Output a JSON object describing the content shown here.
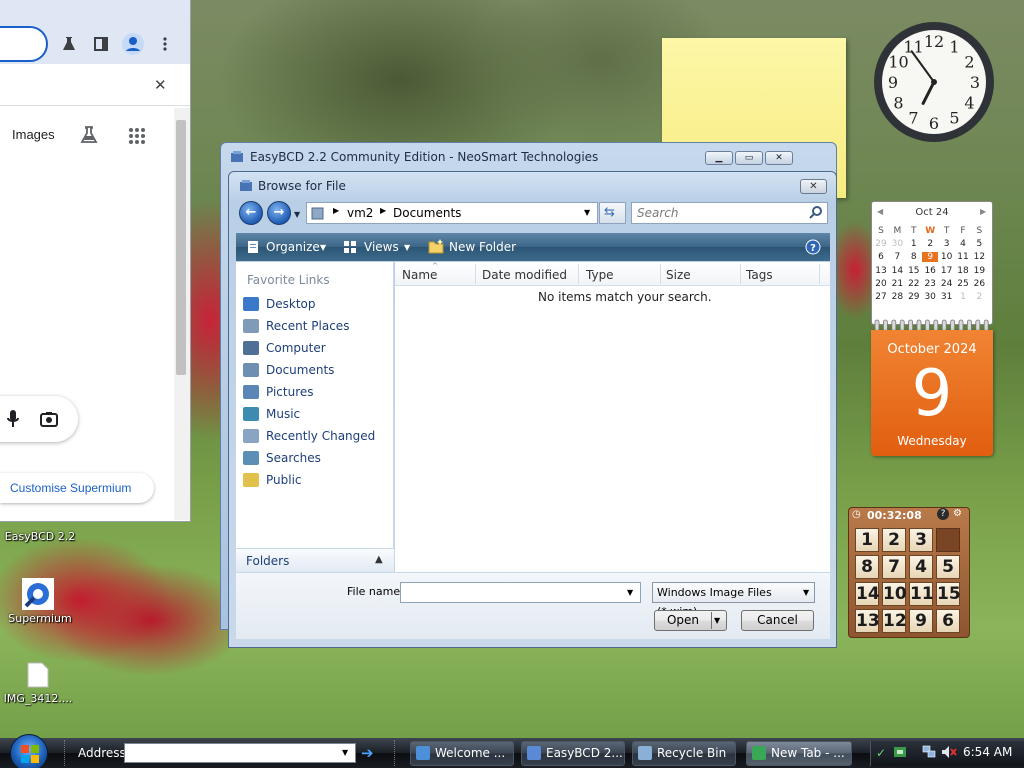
{
  "browser": {
    "images_label": "Images",
    "customise_label": "Customise Supermium"
  },
  "desktop_icons": [
    {
      "label": "EasyBCD 2.2"
    },
    {
      "label": "Supermium"
    },
    {
      "label": "IMG_3412...."
    }
  ],
  "easybcd": {
    "title": "EasyBCD 2.2  Community Edition - NeoSmart Technologies"
  },
  "dialog": {
    "title": "Browse for File",
    "breadcrumb": [
      "vm2",
      "Documents"
    ],
    "search_placeholder": "Search",
    "toolbar": {
      "organize": "Organize",
      "views": "Views",
      "new_folder": "New Folder"
    },
    "favorite_links_heading": "Favorite Links",
    "favorites": [
      {
        "label": "Desktop",
        "icon": "desktop-icon",
        "color": "#3a78c9"
      },
      {
        "label": "Recent Places",
        "icon": "recent-places-icon",
        "color": "#7f9bb8"
      },
      {
        "label": "Computer",
        "icon": "computer-icon",
        "color": "#4f6f97"
      },
      {
        "label": "Documents",
        "icon": "documents-icon",
        "color": "#6e8fb1"
      },
      {
        "label": "Pictures",
        "icon": "pictures-icon",
        "color": "#5b86b8"
      },
      {
        "label": "Music",
        "icon": "music-icon",
        "color": "#3d8bb0"
      },
      {
        "label": "Recently Changed",
        "icon": "recently-changed-icon",
        "color": "#8aa5c4"
      },
      {
        "label": "Searches",
        "icon": "searches-icon",
        "color": "#5b8fb5"
      },
      {
        "label": "Public",
        "icon": "public-icon",
        "color": "#e2c04c"
      }
    ],
    "folders_label": "Folders",
    "columns": [
      "Name",
      "Date modified",
      "Type",
      "Size",
      "Tags"
    ],
    "empty_message": "No items match your search.",
    "file_name_label": "File name:",
    "file_name_value": "",
    "filter": "Windows Image Files (*.wim)",
    "open_label": "Open",
    "cancel_label": "Cancel"
  },
  "calendar": {
    "header": "Oct 24",
    "weekdays": [
      "S",
      "M",
      "T",
      "W",
      "T",
      "F",
      "S"
    ],
    "weeks": [
      [
        "29",
        "30",
        "1",
        "2",
        "3",
        "4",
        "5"
      ],
      [
        "6",
        "7",
        "8",
        "9",
        "10",
        "11",
        "12"
      ],
      [
        "13",
        "14",
        "15",
        "16",
        "17",
        "18",
        "19"
      ],
      [
        "20",
        "21",
        "22",
        "23",
        "24",
        "25",
        "26"
      ],
      [
        "27",
        "28",
        "29",
        "30",
        "31",
        "1",
        "2"
      ]
    ],
    "today": "9",
    "month_year": "October 2024",
    "day_number": "9",
    "weekday_name": "Wednesday"
  },
  "clock": {
    "hour": 6,
    "minute": 54
  },
  "puzzle": {
    "timer": "00:32:08",
    "tiles": [
      "1",
      "2",
      "3",
      "",
      "8",
      "7",
      "4",
      "5",
      "14",
      "10",
      "11",
      "15",
      "13",
      "12",
      "9",
      "6"
    ]
  },
  "taskbar": {
    "address_label": "Address",
    "address_value": "",
    "tasks": [
      {
        "label": "Welcome ...",
        "icon_color": "#4d8fd8"
      },
      {
        "label": "EasyBCD 2....",
        "icon_color": "#5a8ad6"
      },
      {
        "label": "Recycle Bin",
        "icon_color": "#8ab0d8"
      },
      {
        "label": "New Tab - ...",
        "icon_color": "#3aa757"
      }
    ],
    "clock": "6:54 AM"
  }
}
